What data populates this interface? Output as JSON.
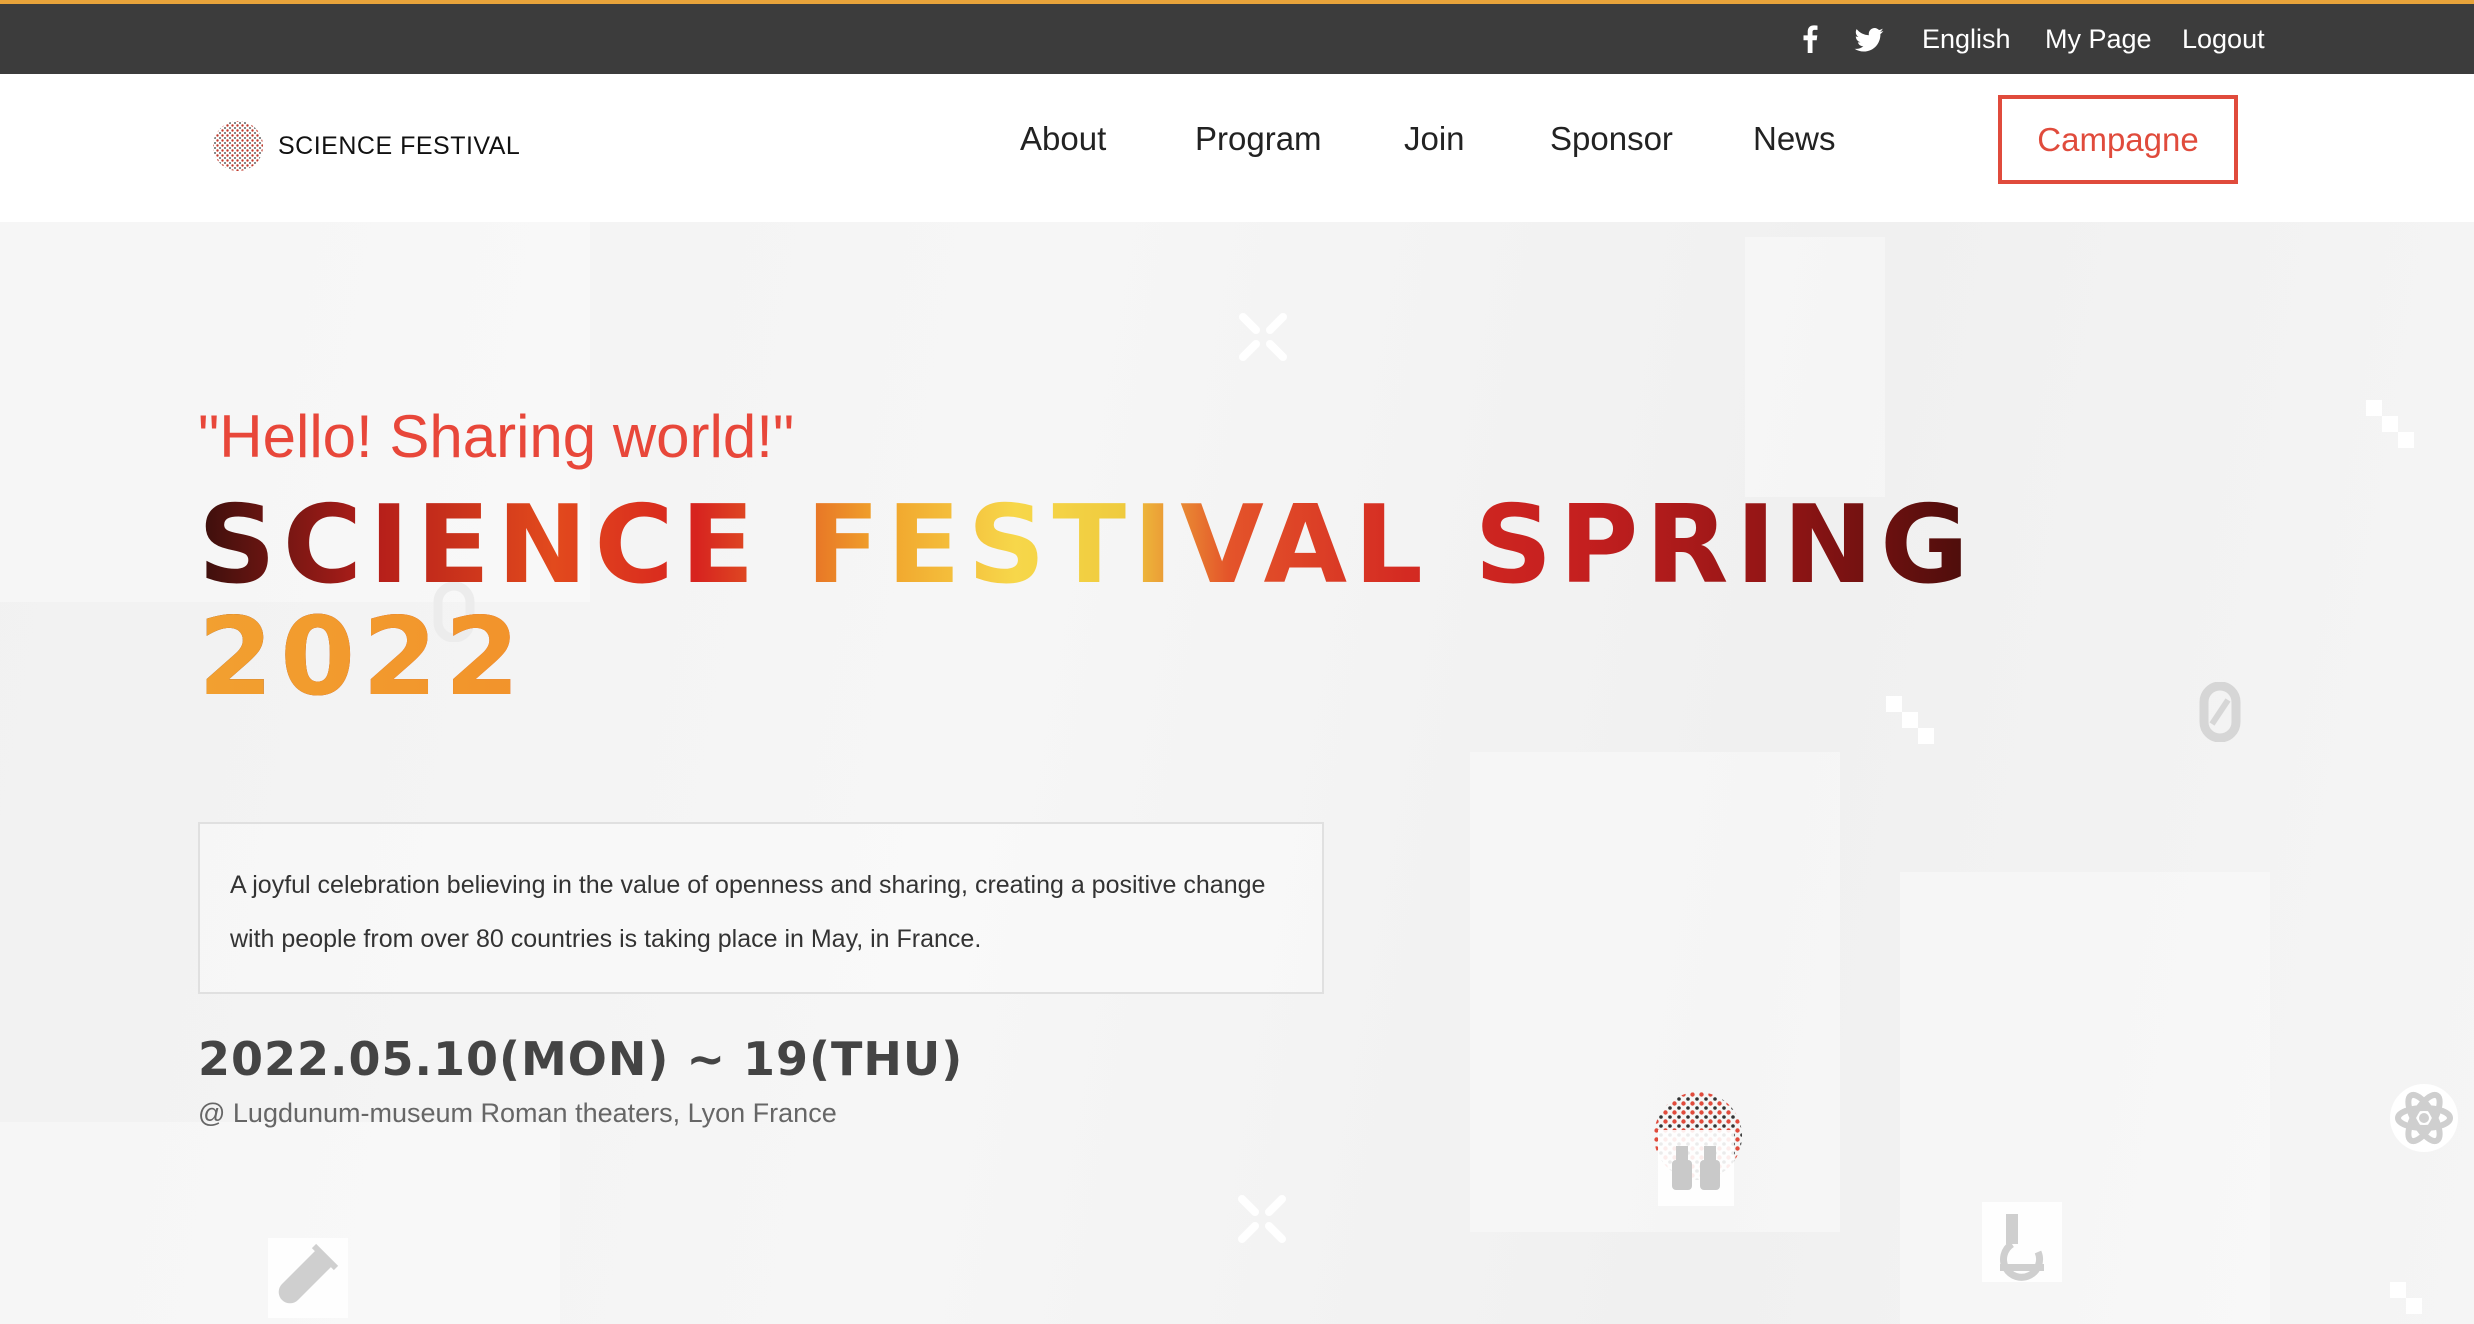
{
  "topbar": {
    "facebook_icon": "facebook-icon",
    "twitter_icon": "twitter-icon",
    "language": "English",
    "my_page": "My Page",
    "logout": "Logout"
  },
  "header": {
    "logo_text": "SCIENCE FESTIVAL",
    "nav": [
      "About",
      "Program",
      "Join",
      "Sponsor",
      "News"
    ],
    "campaign_button": "Campagne"
  },
  "hero": {
    "tagline": "\"Hello! Sharing world!\"",
    "title_line1": "SCIENCE FESTIVAL SPRING",
    "title_line2": "2022",
    "description": "A joyful celebration believing in the value of openness and sharing, creating a positive change with people from over 80 countries is taking place in May, in France.",
    "date": "2022.05.10(MON) ~ 19(THU)",
    "venue": "@ Lugdunum-museum Roman theaters, Lyon France"
  },
  "colors": {
    "topbar_bg": "#3c3c3c",
    "accent_top_border": "#e8a33a",
    "brand_red": "#e04b3c"
  }
}
